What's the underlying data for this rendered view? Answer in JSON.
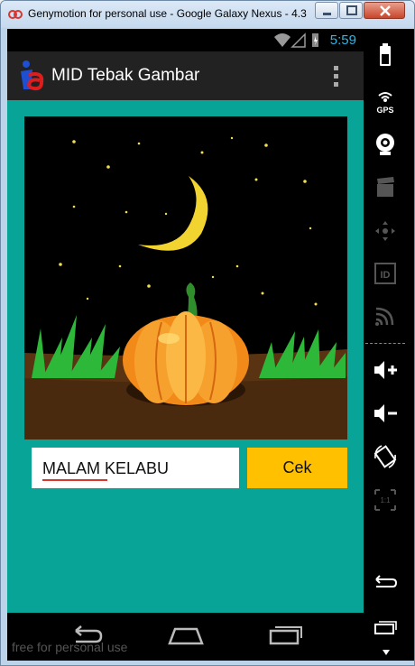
{
  "window": {
    "title": "Genymotion for personal use - Google Galaxy Nexus - 4.3 ..."
  },
  "status_bar": {
    "time": "5:59"
  },
  "app": {
    "title": "MID Tebak Gambar",
    "logo": "app-logo-icon"
  },
  "quiz": {
    "answer_value": "MALAM KELABU",
    "check_label": "Cek",
    "picture": "night-sky-pumpkin-image"
  },
  "navigation": {
    "watermark": "free for personal use"
  },
  "colors": {
    "content_bg": "#07a497",
    "check_button": "#ffc000",
    "clock": "#33b5e5"
  },
  "toolbar": {
    "items": [
      "battery-icon",
      "gps-icon",
      "camera-icon",
      "video-icon",
      "dpad-icon",
      "id-icon",
      "cast-icon",
      "volume-up-icon",
      "volume-down-icon",
      "rotate-icon",
      "scale-icon",
      "back-icon",
      "recent-icon"
    ]
  }
}
